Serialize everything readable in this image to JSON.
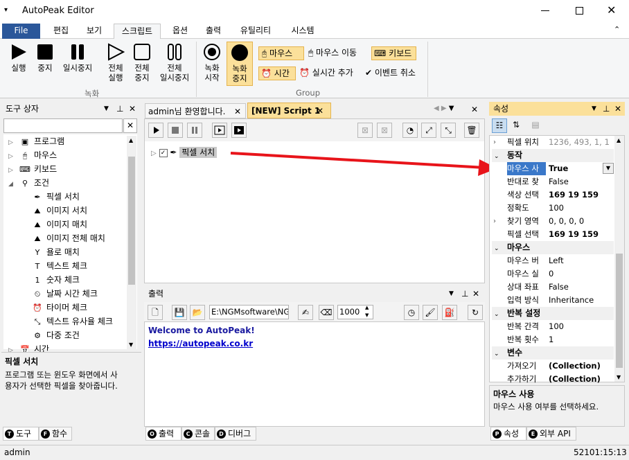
{
  "title": "AutoPeak Editor",
  "ribbon_tabs": [
    "File",
    "편집",
    "보기",
    "스크립트",
    "옵션",
    "출력",
    "유틸리티",
    "시스템"
  ],
  "ribbon": {
    "play": "실행",
    "stop": "중지",
    "pause": "일시중지",
    "all_play": [
      "전체",
      "실행"
    ],
    "all_stop": [
      "전체",
      "중지"
    ],
    "all_pause": [
      "전체",
      "일시중지"
    ],
    "rec_start": [
      "녹화",
      "시작"
    ],
    "rec_stop": [
      "녹화",
      "중지"
    ],
    "group_record": "녹화",
    "mouse": "마우스",
    "mouse_move": "마우스 이동",
    "keyboard": "키보드",
    "time": "시간",
    "realtime_add": "실시간 추가",
    "event_cancel": "이벤트 취소",
    "group_group": "Group"
  },
  "toolbox": {
    "header": "도구 상자",
    "items": [
      {
        "label": "프로그램",
        "level": 0
      },
      {
        "label": "마우스",
        "level": 0
      },
      {
        "label": "키보드",
        "level": 0
      },
      {
        "label": "조건",
        "level": 0
      },
      {
        "label": "픽셀 서치",
        "level": 1
      },
      {
        "label": "이미지 서치",
        "level": 1
      },
      {
        "label": "이미지 매치",
        "level": 1
      },
      {
        "label": "이미지 전체 매치",
        "level": 1
      },
      {
        "label": "욜로 매치",
        "level": 1
      },
      {
        "label": "텍스트 체크",
        "level": 1
      },
      {
        "label": "숫자 체크",
        "level": 1
      },
      {
        "label": "날짜 시간 체크",
        "level": 1
      },
      {
        "label": "타이머 체크",
        "level": 1
      },
      {
        "label": "텍스트 유사율 체크",
        "level": 1
      },
      {
        "label": "다중 조건",
        "level": 1
      },
      {
        "label": "시간",
        "level": 0
      }
    ],
    "desc_title": "픽셀 서치",
    "desc_text_1": "프로그램 또는 윈도우 화면에서 사",
    "desc_text_2": "용자가 선택한 픽셀을 찾아줍니다.",
    "tabs": [
      "도구",
      "함수"
    ],
    "tab_letters": [
      "T",
      "F"
    ]
  },
  "doc_tabs": [
    "admin님 환영합니다.",
    "[NEW] Script 1"
  ],
  "script": {
    "node_label": "픽셀 서치"
  },
  "output": {
    "header": "출력",
    "path": "E:\\NGMsoftware\\NG",
    "number": "1000",
    "welcome": "Welcome to AutoPeak!",
    "link": "https://autopeak.co.kr",
    "tabs": [
      "출력",
      "콘솔",
      "디버그"
    ],
    "tab_letters": [
      "O",
      "C",
      "D"
    ]
  },
  "props": {
    "header": "속성",
    "pixel_pos_label": "픽셀 위치",
    "pixel_pos_value": "1236, 493, 1, 1",
    "cat_action": "동작",
    "rows_action": [
      {
        "k": "마우스 사",
        "v": "True",
        "bold": true,
        "sel": true
      },
      {
        "k": "반대로 찾",
        "v": "False",
        "bold": false
      },
      {
        "k": "색상 선택",
        "v": "169 19 159",
        "bold": true
      },
      {
        "k": "정확도",
        "v": "100",
        "bold": false
      },
      {
        "k": "찾기 영역",
        "v": "0, 0, 0, 0",
        "bold": false
      },
      {
        "k": "픽셀 선택",
        "v": "169 19 159",
        "bold": true
      }
    ],
    "cat_mouse": "마우스",
    "rows_mouse": [
      {
        "k": "마우스 버",
        "v": "Left",
        "bold": false
      },
      {
        "k": "마우스 실",
        "v": "0",
        "bold": false
      },
      {
        "k": "상대 좌표",
        "v": "False",
        "bold": false
      },
      {
        "k": "입력 방식",
        "v": "Inheritance",
        "bold": false
      }
    ],
    "cat_repeat": "반복 설정",
    "rows_repeat": [
      {
        "k": "반복 간격",
        "v": "100",
        "bold": false
      },
      {
        "k": "반복 횟수",
        "v": "1",
        "bold": false
      }
    ],
    "cat_var": "변수",
    "rows_var": [
      {
        "k": "가져오기",
        "v": "(Collection)",
        "bold": true
      },
      {
        "k": "추가하기",
        "v": "(Collection)",
        "bold": true
      }
    ],
    "desc_title": "마우스 사용",
    "desc_text": "마우스 사용 여부를 선택하세요.",
    "tabs": [
      "속성",
      "외부 API"
    ],
    "tab_letters": [
      "P",
      "E"
    ]
  },
  "status": {
    "user": "admin",
    "time": "52101:15:13"
  },
  "colors": {
    "file_tab": "#2b579a",
    "highlight": "#fbe09a",
    "link": "#0000cc",
    "arrow": "#e8141a",
    "welcome": "#1a1aa0"
  }
}
